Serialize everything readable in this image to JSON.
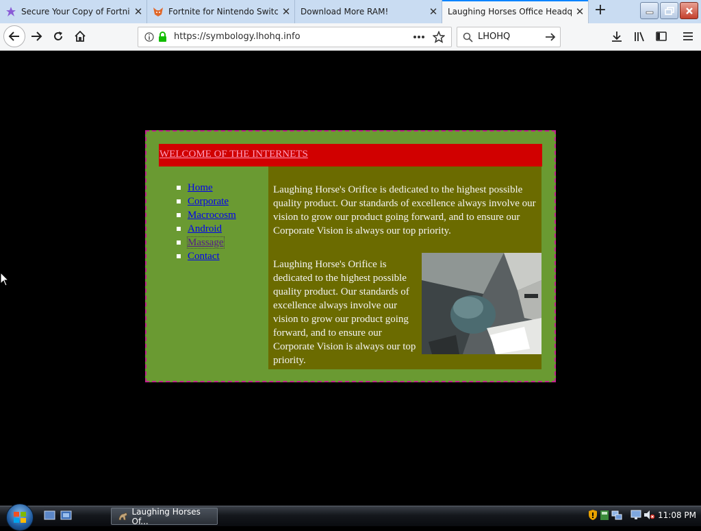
{
  "browser": {
    "tabs": [
      {
        "title": "Secure Your Copy of Fortnite",
        "favicon": "star-icon",
        "active": false
      },
      {
        "title": "Fortnite for Nintendo Switch",
        "favicon": "fox-icon",
        "active": false
      },
      {
        "title": "Download More RAM!",
        "favicon": "none",
        "active": false
      },
      {
        "title": "Laughing Horses Office Headquarters",
        "favicon": "none",
        "active": true
      }
    ],
    "new_tab_symbol": "+",
    "tab_close_symbol": "✕",
    "url": "https://symbology.lhohq.info",
    "search_value": "LHOHQ",
    "accent_color": "#0a84ff"
  },
  "page": {
    "background": "#000000",
    "welcome_text": "WELCOME OF THE INTERNETS",
    "nav_items": [
      {
        "label": "Home",
        "visited": false
      },
      {
        "label": "Corporate",
        "visited": false
      },
      {
        "label": "Macrocosm",
        "visited": false
      },
      {
        "label": "Android",
        "visited": false
      },
      {
        "label": "Massage",
        "visited": true
      },
      {
        "label": "Contact",
        "visited": false
      }
    ],
    "paragraph_1": "Laughing Horse's Orifice is dedicated to the highest possible quality product. Our standards of excellence always involve our vision to grow our product going forward, and to ensure our Corporate Vision is always our top priority.",
    "paragraph_2": "Laughing Horse's Orifice is dedicated to the highest possible quality product. Our standards of excellence always involve our vision to grow our product going forward, and to ensure our Corporate Vision is always our top priority.",
    "colors": {
      "outer_box": "#6a9a32",
      "outer_border": "#c2228e",
      "welcome_bar": "#d10000",
      "welcome_link": "#ff9fc0",
      "content_panel": "#6b6b00"
    }
  },
  "taskbar": {
    "task_label": "Laughing Horses Of...",
    "clock": "11:08 PM"
  }
}
